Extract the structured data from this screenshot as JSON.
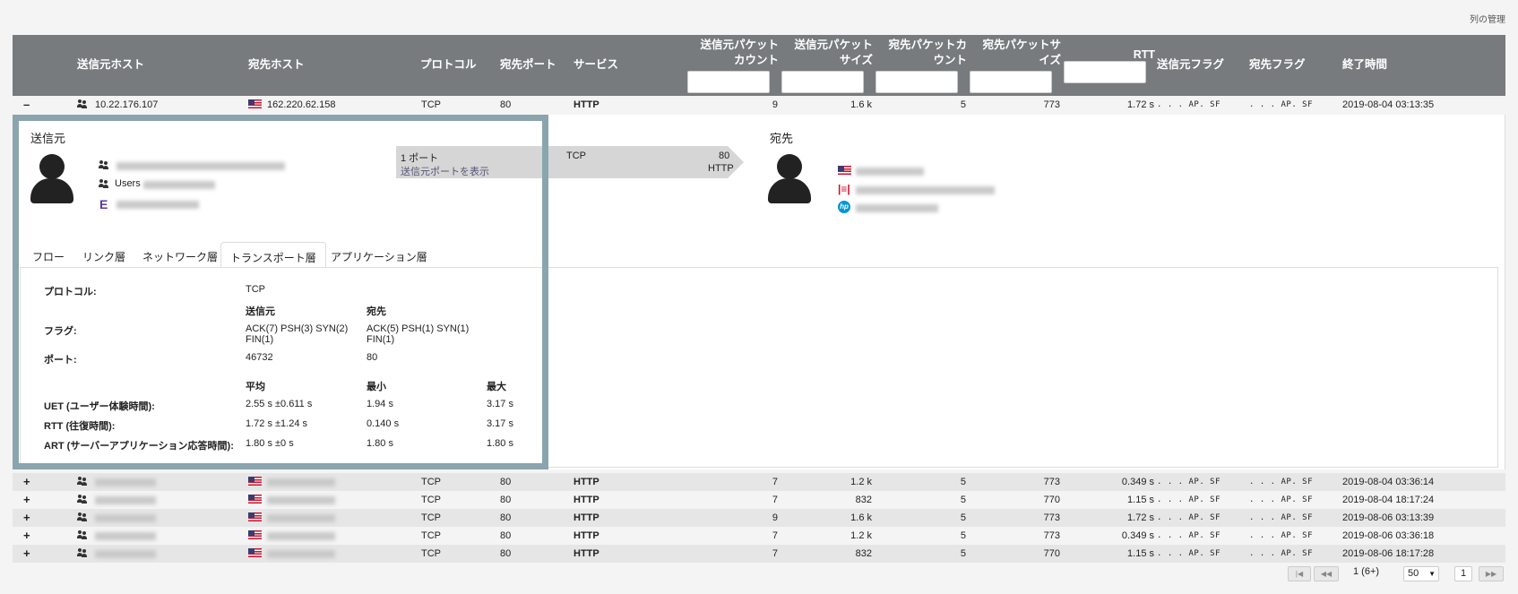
{
  "manage_columns": "列の管理",
  "headers": {
    "src_host": "送信元ホスト",
    "dst_host": "宛先ホスト",
    "protocol": "プロトコル",
    "dst_port": "宛先ポート",
    "service": "サービス",
    "src_pkt_count_1": "送信元パケット",
    "src_pkt_count_2": "カウント",
    "src_pkt_size_1": "送信元パケット",
    "src_pkt_size_2": "サイズ",
    "dst_pkt_count_1": "宛先パケットカ",
    "dst_pkt_count_2": "ウント",
    "dst_pkt_size_1": "宛先パケットサ",
    "dst_pkt_size_2": "イズ",
    "rtt": "RTT",
    "src_flag": "送信元フラグ",
    "dst_flag": "宛先フラグ",
    "end_time": "終了時間"
  },
  "expanded_row": {
    "toggle": "–",
    "src": "10.22.176.107",
    "dst": "162.220.62.158",
    "protocol": "TCP",
    "port": "80",
    "service": "HTTP",
    "spc": "9",
    "sps": "1.6 k",
    "dpc": "5",
    "dps": "773",
    "rtt": "1.72 s",
    "sflag": ". . . AP. SF",
    "dflag": ". . . AP. SF",
    "end": "2019-08-04 03:13:35"
  },
  "detail": {
    "src_title": "送信元",
    "dst_title": "宛先",
    "src_users": "Users",
    "arrow_ports": "1 ポート",
    "arrow_link": "送信元ポートを表示",
    "arrow_proto": "TCP",
    "arrow_port": "80",
    "arrow_service": "HTTP",
    "tabs": [
      "フロー",
      "リンク層",
      "ネットワーク層",
      "トランスポート層",
      "アプリケーション層"
    ],
    "protocol_label": "プロトコル:",
    "protocol_value": "TCP",
    "col_src": "送信元",
    "col_dst": "宛先",
    "flags_label": "フラグ:",
    "flags_src_1": "ACK(7) PSH(3) SYN(2)",
    "flags_src_2": "FIN(1)",
    "flags_dst_1": "ACK(5) PSH(1) SYN(1)",
    "flags_dst_2": "FIN(1)",
    "port_label": "ポート:",
    "port_src": "46732",
    "port_dst": "80",
    "col_avg": "平均",
    "col_min": "最小",
    "col_max": "最大",
    "metrics": [
      {
        "label": "UET (ユーザー体験時間):",
        "avg": "2.55 s ±0.611 s",
        "min": "1.94 s",
        "max": "3.17 s"
      },
      {
        "label": "RTT (往復時間):",
        "avg": "1.72 s ±1.24 s",
        "min": "0.140 s",
        "max": "3.17 s"
      },
      {
        "label": "ART (サーバーアプリケーション応答時間):",
        "avg": "1.80 s ±0 s",
        "min": "1.80 s",
        "max": "1.80 s"
      }
    ]
  },
  "rows": [
    {
      "toggle": "+",
      "protocol": "TCP",
      "port": "80",
      "service": "HTTP",
      "spc": "7",
      "sps": "1.2 k",
      "dpc": "5",
      "dps": "773",
      "rtt": "0.349 s",
      "sflag": ". . . AP. SF",
      "dflag": ". . . AP. SF",
      "end": "2019-08-04 03:36:14"
    },
    {
      "toggle": "+",
      "protocol": "TCP",
      "port": "80",
      "service": "HTTP",
      "spc": "7",
      "sps": "832",
      "dpc": "5",
      "dps": "770",
      "rtt": "1.15 s",
      "sflag": ". . . AP. SF",
      "dflag": ". . . AP. SF",
      "end": "2019-08-04 18:17:24"
    },
    {
      "toggle": "+",
      "protocol": "TCP",
      "port": "80",
      "service": "HTTP",
      "spc": "9",
      "sps": "1.6 k",
      "dpc": "5",
      "dps": "773",
      "rtt": "1.72 s",
      "sflag": ". . . AP. SF",
      "dflag": ". . . AP. SF",
      "end": "2019-08-06 03:13:39"
    },
    {
      "toggle": "+",
      "protocol": "TCP",
      "port": "80",
      "service": "HTTP",
      "spc": "7",
      "sps": "1.2 k",
      "dpc": "5",
      "dps": "773",
      "rtt": "0.349 s",
      "sflag": ". . . AP. SF",
      "dflag": ". . . AP. SF",
      "end": "2019-08-06 03:36:18"
    },
    {
      "toggle": "+",
      "protocol": "TCP",
      "port": "80",
      "service": "HTTP",
      "spc": "7",
      "sps": "832",
      "dpc": "5",
      "dps": "770",
      "rtt": "1.15 s",
      "sflag": ". . . AP. SF",
      "dflag": ". . . AP. SF",
      "end": "2019-08-06 18:17:28"
    }
  ],
  "pager": {
    "info": "1 (6+)",
    "size": "50",
    "page": "1"
  },
  "colors": {
    "header_bg": "#777b7e",
    "panel_border": "#8aa5ad",
    "row_alt": "#e6e6e6"
  }
}
